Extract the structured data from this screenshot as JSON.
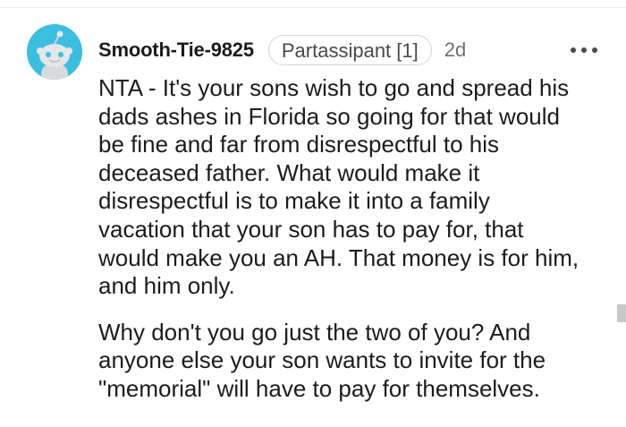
{
  "comment": {
    "username": "Smooth-Tie-9825",
    "flair": "Partassipant [1]",
    "timestamp": "2d",
    "avatar_icon": "snoo-avatar-icon",
    "more_icon": "more-options-icon",
    "paragraphs": [
      "NTA - It's your sons wish to go and spread his\ndads ashes in Florida so going for that would\nbe fine and far from disrespectful to his\ndeceased father. What would make it\ndisrespectful is to make it into a family\nvacation that your son has to pay for, that\nwould make you an AH. That money is for him,\nand him only.",
      "Why don't you go just the two of you? And\nanyone else your son wants to invite for the\n\"memorial\" will have to pay for themselves."
    ]
  },
  "colors": {
    "avatar_bg": "#3bbfe0",
    "text": "#1c1c1c",
    "meta_text": "#6f6f6f",
    "flair_border": "#d4d4d4"
  }
}
